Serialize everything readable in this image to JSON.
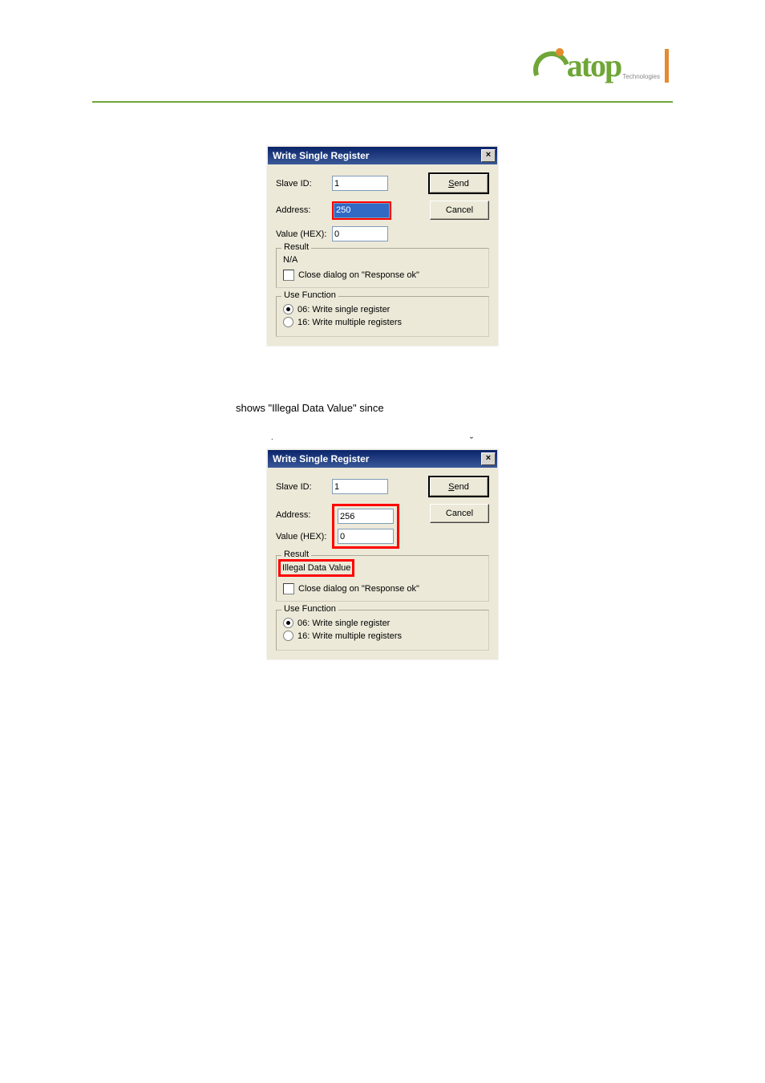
{
  "logo": {
    "word": "atop",
    "sub": "Technologies"
  },
  "caption": "shows \"Illegal Data Value\" since",
  "dialog1": {
    "title": "Write Single Register",
    "slave_label": "Slave ID:",
    "slave_value": "1",
    "addr_label": "Address:",
    "addr_value": "250",
    "value_label": "Value (HEX):",
    "value_value": "0",
    "send": "Send",
    "cancel": "Cancel",
    "result_legend": "Result",
    "result_value": "N/A",
    "close_chk": "Close dialog on \"Response ok\"",
    "usefn_legend": "Use Function",
    "fn06": "06: Write single register",
    "fn16": "16: Write multiple registers"
  },
  "dialog2": {
    "title": "Write Single Register",
    "slave_label": "Slave ID:",
    "slave_value": "1",
    "addr_label": "Address:",
    "addr_value": "256",
    "value_label": "Value (HEX):",
    "value_value": "0",
    "send": "Send",
    "cancel": "Cancel",
    "result_legend": "Result",
    "result_value": "Illegal Data Value",
    "close_chk": "Close dialog on \"Response ok\"",
    "usefn_legend": "Use Function",
    "fn06": "06: Write single register",
    "fn16": "16: Write multiple registers"
  }
}
